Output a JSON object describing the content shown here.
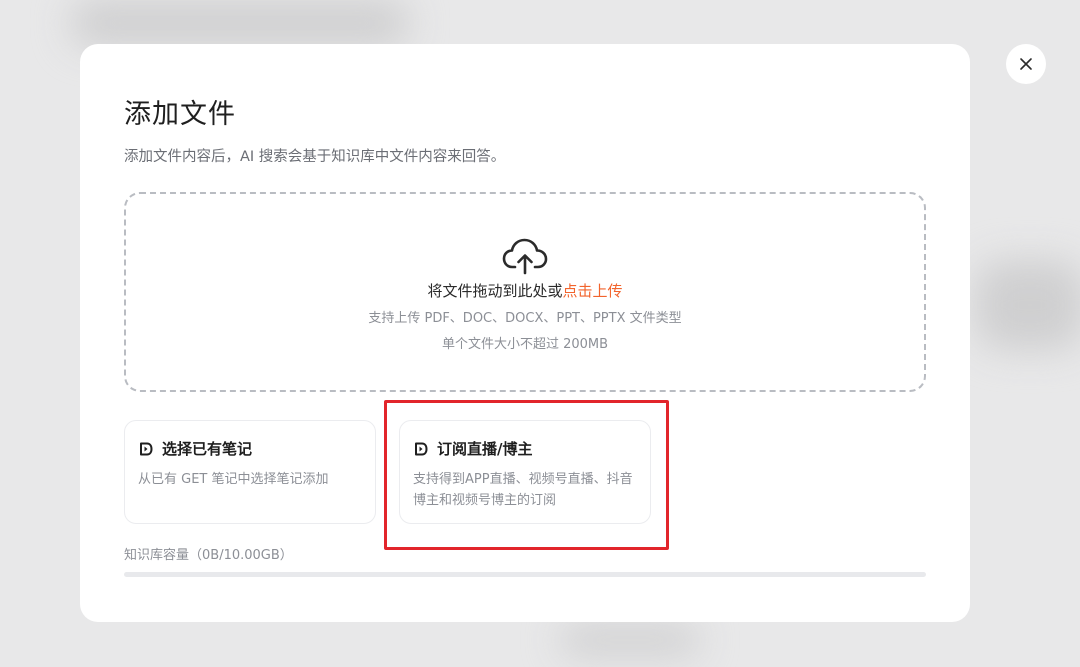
{
  "modal": {
    "title": "添加文件",
    "subtitle": "添加文件内容后，AI 搜索会基于知识库中文件内容来回答。"
  },
  "dropzone": {
    "text_prefix": "将文件拖动到此处或",
    "link": "点击上传",
    "types": "支持上传 PDF、DOC、DOCX、PPT、PPTX 文件类型",
    "size_limit": "单个文件大小不超过 200MB",
    "icon": "cloud-upload-icon"
  },
  "cards": [
    {
      "title": "选择已有笔记",
      "description": "从已有 GET 笔记中选择笔记添加",
      "icon": "note-link-icon"
    },
    {
      "title": "订阅直播/博主",
      "description": "支持得到APP直播、视频号直播、抖音博主和视频号博主的订阅",
      "icon": "note-link-icon"
    }
  ],
  "capacity": {
    "label": "知识库容量（0B/10.00GB）",
    "used_fraction": 0
  },
  "colors": {
    "accent": "#f2642d",
    "highlight": "#e2252b"
  },
  "close_icon": "close-icon"
}
